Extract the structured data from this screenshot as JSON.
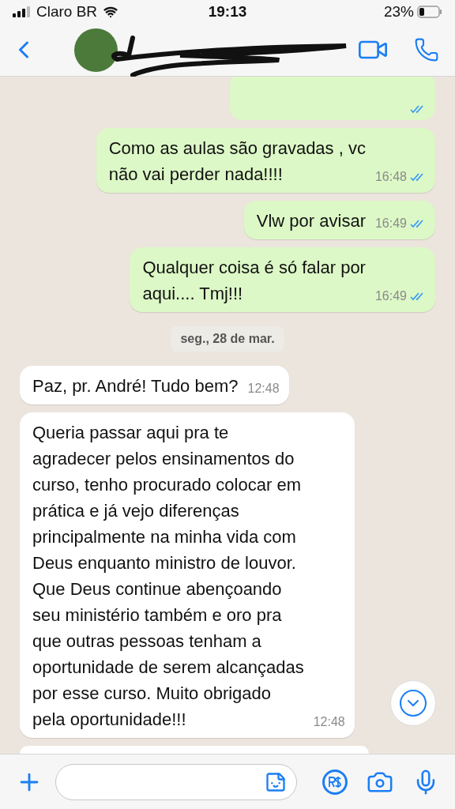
{
  "status_bar": {
    "carrier": "Claro BR",
    "time": "19:13",
    "battery": "23%"
  },
  "header": {
    "name_redacted": true
  },
  "messages": [
    {
      "kind": "partial_out",
      "read": true
    },
    {
      "kind": "out",
      "text": "Como as aulas são gravadas , vc\nnão vai perder nada!!!!",
      "time": "16:48",
      "read": true
    },
    {
      "kind": "out",
      "text": "Vlw por avisar",
      "time": "16:49",
      "read": true
    },
    {
      "kind": "out",
      "text": "Qualquer coisa é só falar por\naqui.... Tmj!!!",
      "time": "16:49",
      "read": true
    },
    {
      "kind": "date",
      "text": "seg., 28 de mar."
    },
    {
      "kind": "in",
      "text": "Paz, pr. André! Tudo bem?",
      "time": "12:48"
    },
    {
      "kind": "in",
      "text": "Queria passar aqui pra te\nagradecer pelos ensinamentos do\ncurso, tenho procurado colocar em\nprática e já vejo diferenças\nprincipalmente na minha vida com\nDeus enquanto ministro de louvor.\nQue Deus continue abençoando\nseu ministério também e oro pra\nque outras pessoas tenham a\noportunidade de serem alcançadas\npor esse curso. Muito obrigado\npela oportunidade!!!",
      "time": "12:48"
    },
    {
      "kind": "partial_in"
    }
  ]
}
